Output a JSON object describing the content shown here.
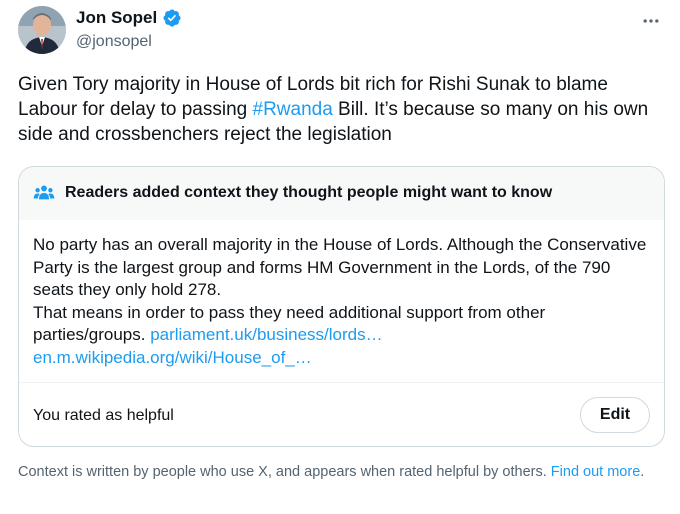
{
  "author": {
    "name": "Jon Sopel",
    "handle": "@jonsopel",
    "verified": true,
    "avatar_icon": "profile-photo",
    "verified_color": "#1d9bf0"
  },
  "tweet": {
    "text_before": "Given Tory majority in House of Lords bit rich for Rishi Sunak to blame Labour for delay to passing ",
    "hashtag": "#Rwanda",
    "text_after": " Bill. It’s because so many on his own side and crossbenchers reject the legislation"
  },
  "community_note": {
    "title": "Readers added context they thought people might want to know",
    "icon": "people-icon",
    "body_line1": "No party has an overall majority in the House of Lords. Although the Conservative Party is the largest group and forms HM Government in the Lords, of the 790 seats they only hold 278.",
    "body_line2": "That means in order to pass they need additional support from other parties/groups. ",
    "link1": "parliament.uk/business/lords…",
    "link2": "en.m.wikipedia.org/wiki/House_of_…",
    "rated_text": "You rated as helpful",
    "edit_label": "Edit"
  },
  "footer": {
    "text": "Context is written by people who use X, and appears when rated helpful by others. ",
    "link": "Find out more",
    "period": "."
  },
  "colors": {
    "accent": "#1d9bf0",
    "secondary_text": "#536471",
    "border": "#cfd9de"
  }
}
